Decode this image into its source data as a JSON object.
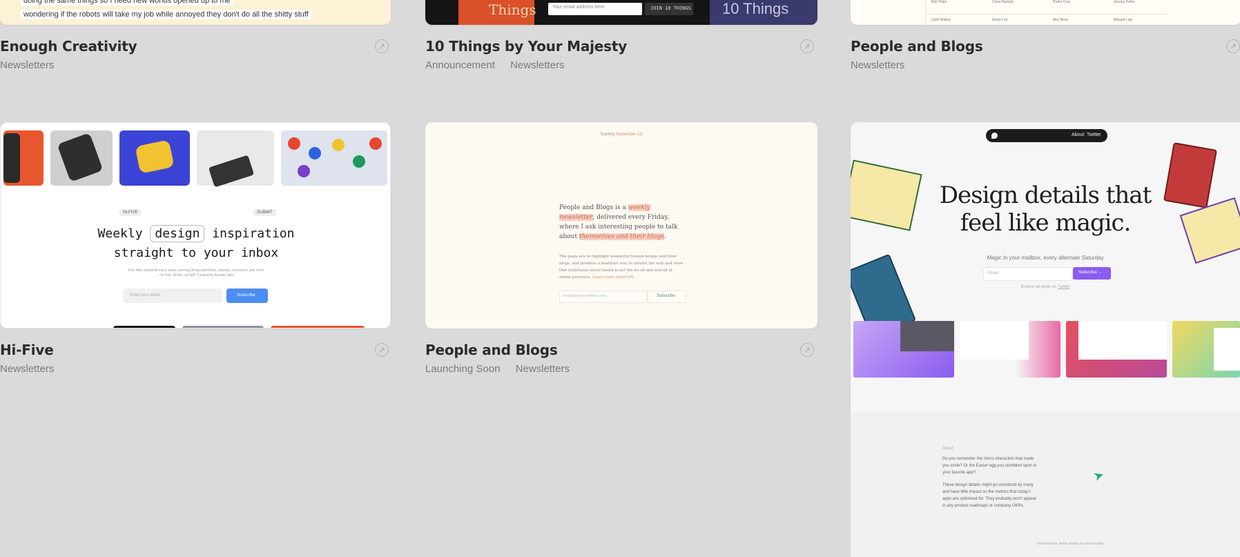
{
  "cards": [
    {
      "title": "Enough Creativity",
      "tags": [
        "Newsletters"
      ],
      "thumb": {
        "lines": [
          "doing the same things so I need new worlds opened up to me",
          "wondering if the robots will take my job while annoyed they don't do all the shitty stuff"
        ]
      }
    },
    {
      "title": "10 Things by Your Majesty",
      "tags": [
        "Announcement",
        "Newsletters"
      ],
      "thumb": {
        "email_placeholder": "Your email address here",
        "join_button": "JOIN 10 THINGS",
        "brand_left": "Things",
        "brand_right": "10 Things"
      }
    },
    {
      "title": "People and Blogs",
      "tags": [
        "Newsletters"
      ],
      "thumb": {
        "table_rows": [
          [
            "Bob Hope",
            "Clara Hannah",
            "Pedro Cruz",
            "Jeremy Keller"
          ],
          [
            "Colin Walker",
            "Annie Lee",
            "Mac Beck",
            "Manuel Lutz"
          ]
        ]
      }
    },
    {
      "title": "Hi-Five",
      "tags": [
        "Newsletters"
      ],
      "thumb": {
        "chip_left": "HI-FIVE",
        "chip_right": "SUBMIT",
        "headline_a": "Weekly",
        "headline_word": "design",
        "headline_b": "inspiration",
        "headline_line2": "straight to your inbox",
        "subtext": "Five links delivered every week covering design portfolios, startups, resources, and more – for free. All fire, no fluff. Curated by Arcade Labs.",
        "email_placeholder": "Enter your email",
        "subscribe_button": "Subscribe"
      }
    },
    {
      "title": "People and Blogs",
      "tags": [
        "Launching Soon",
        "Newsletters"
      ],
      "thumb": {
        "starting": "Starting",
        "starting_date": "September 1st",
        "lead_1": "People and Blogs is a ",
        "lead_hl1": "weekly newsletter",
        "lead_2": ", delivered every Friday, where I ask interesting people to talk about ",
        "lead_hl2": "themselves and their blogs",
        "lead_3": ".",
        "body": "The goals are to highlight wonderful human beings and their blogs, and promote a healthier way to inhabit the web and show that traditional social media is not the be-all and end-all of online presence.",
        "learn_more": "Learn more about PB",
        "email_placeholder": "email@peopleandblogs.com",
        "subscribe_button": "Subscribe"
      }
    },
    {
      "title": "",
      "tags": [],
      "thumb": {
        "nav_about": "About",
        "nav_twitter": "Twitter",
        "headline_1": "Design details that",
        "headline_2": "feel like magic.",
        "subhead": "Magic in your mailbox, every alternate Saturday",
        "email_placeholder": "Email",
        "subscribe_button": "Subscribe →",
        "browse": "Browse all posts on",
        "browse_link": "Twitter",
        "about_label": "About",
        "about_p1": "Do you remember the micro-interaction that made you smile? Or the Easter egg you stumbled upon in your favorite app?",
        "about_p2": "These design details might go unnoticed by many and have little impact on the metrics that today's apps are optimised for. They probably won't appear in any product roadmaps or company OKRs.",
        "footer_note": "Nevertheless, these details do not translate..."
      }
    }
  ]
}
